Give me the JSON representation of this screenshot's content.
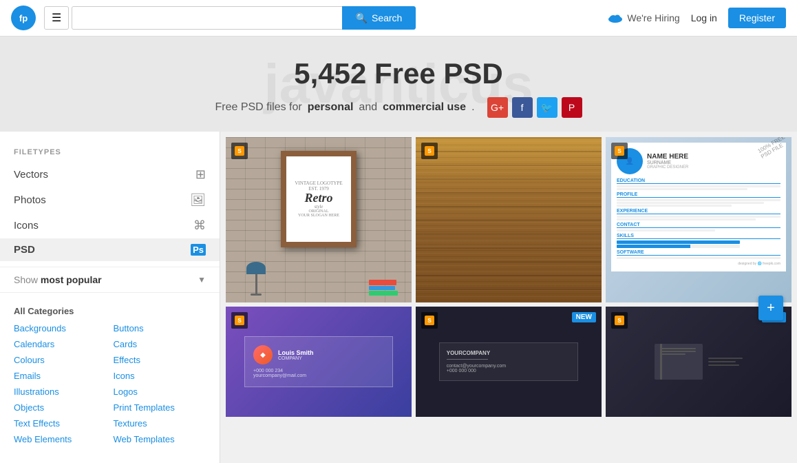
{
  "header": {
    "logo_alt": "Freepik",
    "hamburger_label": "☰",
    "search_placeholder": "",
    "search_button_label": "Search",
    "search_icon": "🔍",
    "hiring_label": "We're Hiring",
    "login_label": "Log in",
    "register_label": "Register"
  },
  "hero": {
    "bg_text": "javanticus",
    "title": "5,452 Free PSD",
    "subtitle_start": "Free PSD files for ",
    "subtitle_personal": "personal",
    "subtitle_middle": " and ",
    "subtitle_commercial": "commercial use",
    "subtitle_end": "."
  },
  "social": {
    "gplus": "G+",
    "fb": "f",
    "tw": "🐦",
    "pi": "P"
  },
  "sidebar": {
    "section_title": "FILETYPES",
    "filetypes": [
      {
        "label": "Vectors",
        "icon": "⊞"
      },
      {
        "label": "Photos",
        "icon": "🖼"
      },
      {
        "label": "Icons",
        "icon": "⌘"
      },
      {
        "label": "PSD",
        "icon": "Ps"
      }
    ],
    "show_label": "Show",
    "popular_label": "most popular",
    "categories": {
      "all": "All Categories",
      "left_col": [
        "Backgrounds",
        "Calendars",
        "Colours",
        "Emails",
        "Illustrations",
        "Objects",
        "Text Effects",
        "Web Elements"
      ],
      "right_col": [
        "Buttons",
        "Cards",
        "Effects",
        "Icons",
        "Logos",
        "Print Templates",
        "Textures",
        "Web Templates"
      ]
    }
  },
  "images": [
    {
      "id": 1,
      "type": "retro",
      "badge": "S",
      "new": false
    },
    {
      "id": 2,
      "type": "wood",
      "badge": "S",
      "new": false
    },
    {
      "id": 3,
      "type": "resume",
      "badge": "S",
      "new": false,
      "watermark": "100% FREE PSD FILE"
    },
    {
      "id": 4,
      "type": "business-card",
      "badge": "S",
      "new": false
    },
    {
      "id": 5,
      "type": "dark-card",
      "badge": "S",
      "new": true
    },
    {
      "id": 6,
      "type": "notebook",
      "badge": "S",
      "new": true
    }
  ],
  "float_button": "+"
}
